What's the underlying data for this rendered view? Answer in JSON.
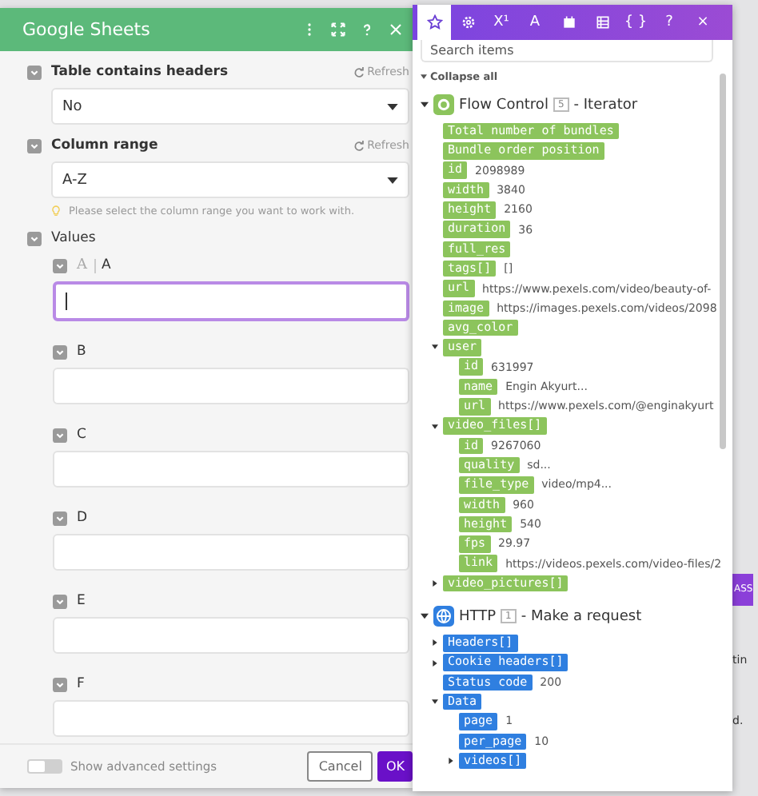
{
  "dialog": {
    "title": "Google Sheets",
    "header_icons": [
      {
        "kind": "kebab"
      },
      {
        "kind": "expand"
      },
      {
        "kind": "help"
      },
      {
        "kind": "close"
      }
    ],
    "fields": [
      {
        "label": "Table contains headers",
        "refresh": "Refresh",
        "value": "No"
      },
      {
        "label": "Column range",
        "refresh": "Refresh",
        "value": "A-Z",
        "hint": "Please select the column range you want to work with."
      }
    ],
    "values": {
      "label": "Values",
      "items": [
        {
          "label": "A",
          "type_glyph": "A",
          "focused": true
        },
        {
          "label": "B",
          "focused": false
        },
        {
          "label": "C",
          "focused": false
        },
        {
          "label": "D",
          "focused": false
        },
        {
          "label": "E",
          "focused": false
        },
        {
          "label": "F",
          "focused": false
        }
      ]
    },
    "footer": {
      "toggle_label": "Show advanced settings",
      "toggle_on": false,
      "buttons": [
        "Cancel",
        "OK"
      ]
    }
  },
  "mapping_panel": {
    "tabs": [
      {
        "kind": "star",
        "selected": true
      },
      {
        "kind": "gear",
        "selected": false
      },
      {
        "kind": "glyph",
        "glyph": "X¹",
        "selected": false
      },
      {
        "kind": "glyph",
        "glyph": "A",
        "selected": false
      },
      {
        "kind": "calendar",
        "selected": false
      },
      {
        "kind": "table",
        "selected": false
      },
      {
        "kind": "glyph",
        "glyph": "{ }",
        "selected": false
      },
      {
        "kind": "glyph",
        "glyph": "?",
        "selected": false
      },
      {
        "kind": "glyph",
        "glyph": "×",
        "selected": false
      }
    ],
    "search": {
      "placeholder": "Search items"
    },
    "collapse_all": "Collapse all",
    "modules": [
      {
        "name": "Flow Control",
        "number": "5",
        "action": "- Iterator",
        "kind": "flow",
        "color": "#8cc45c",
        "expanded": true,
        "items": [
          {
            "key": "Total number of bundles"
          },
          {
            "key": "Bundle order position"
          },
          {
            "key": "id",
            "value": "2098989"
          },
          {
            "key": "width",
            "value": "3840"
          },
          {
            "key": "height",
            "value": "2160"
          },
          {
            "key": "duration",
            "value": "36"
          },
          {
            "key": "full_res"
          },
          {
            "key": "tags[]",
            "value": "[]"
          },
          {
            "key": "url",
            "value": "https://www.pexels.com/video/beauty-of-"
          },
          {
            "key": "image",
            "value": "https://images.pexels.com/videos/2098"
          },
          {
            "key": "avg_color"
          },
          {
            "key": "user",
            "expanded": true,
            "children": [
              {
                "key": "id",
                "value": "631997"
              },
              {
                "key": "name",
                "value": "Engin Akyurt..."
              },
              {
                "key": "url",
                "value": "https://www.pexels.com/@enginakyurt"
              }
            ]
          },
          {
            "key": "video_files[]",
            "expanded": true,
            "children": [
              {
                "key": "id",
                "value": "9267060"
              },
              {
                "key": "quality",
                "value": "sd..."
              },
              {
                "key": "file_type",
                "value": "video/mp4..."
              },
              {
                "key": "width",
                "value": "960"
              },
              {
                "key": "height",
                "value": "540"
              },
              {
                "key": "fps",
                "value": "29.97"
              },
              {
                "key": "link",
                "value": "https://videos.pexels.com/video-files/2"
              }
            ]
          },
          {
            "key": "video_pictures[]",
            "expanded": false
          }
        ]
      },
      {
        "name": "HTTP",
        "number": "1",
        "action": "- Make a request",
        "kind": "http",
        "color": "#2f7fe0",
        "expanded": true,
        "items": [
          {
            "key": "Headers[]",
            "expanded": false
          },
          {
            "key": "Cookie headers[]",
            "expanded": false
          },
          {
            "key": "Status code",
            "value": "200"
          },
          {
            "key": "Data",
            "expanded": true,
            "children": [
              {
                "key": "page",
                "value": "1"
              },
              {
                "key": "per_page",
                "value": "10"
              },
              {
                "key": "videos[]",
                "expanded": false
              }
            ]
          }
        ]
      }
    ]
  },
  "background": {
    "button": "ASS",
    "texts": [
      "tin",
      "d."
    ]
  }
}
